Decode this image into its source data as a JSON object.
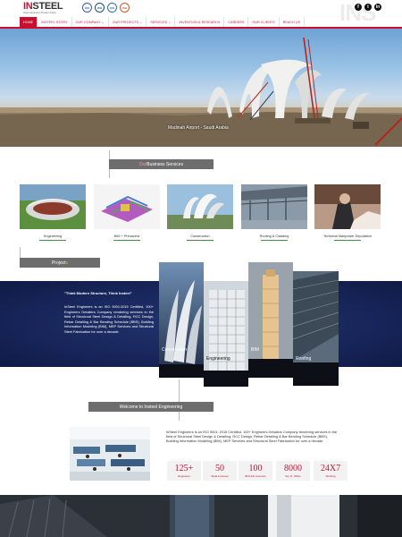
{
  "header": {
    "logo": "INSTEEL",
    "logo_tagline": "Insteel Engineers Private Limited",
    "cert_badges": [
      "ISO",
      "ISO",
      "ISO",
      "ISO"
    ],
    "watermark": "INS",
    "social": [
      "facebook-icon",
      "twitter-icon",
      "linkedin-icon"
    ]
  },
  "nav": {
    "items": [
      {
        "label": "HOME",
        "active": true
      },
      {
        "label": "INSTEEL STORY"
      },
      {
        "label": "OUR COMPANY ⌄"
      },
      {
        "label": "OUR PROJECTS ⌄"
      },
      {
        "label": "SERVICES ⌄"
      },
      {
        "label": "INVENTION & RESEARCH"
      },
      {
        "label": "CAREERS"
      },
      {
        "label": "OUR CLIENTS"
      },
      {
        "label": "REACH US"
      }
    ]
  },
  "hero": {
    "caption": "Madinah Airport - Saudi Arabia"
  },
  "services": {
    "title_prefix": "Our",
    "title_rest": " Business Services",
    "items": [
      {
        "label": "Engineering"
      },
      {
        "label": "BIM + Primavera"
      },
      {
        "label": "Construction"
      },
      {
        "label": "Roofing & Cladding"
      },
      {
        "label": "Technical Manpower Deputation"
      }
    ]
  },
  "projects": {
    "title_prefix": "Project",
    "title_rest": "s",
    "heading": "\"Think Modern Structure, Think Insteel\"",
    "text": "InSteel Engineers is an ISO 9001:2015 Certified, 100+ Engineers Detailers Company rendering services in the field of Structural Steel Design & Detailing, RCC Design, Rebar Detailing & Bar Bending Schedule (BBS), Building Information Modeling (BIM), MEP Services and Structural Steel Fabrication for over a decade.",
    "cards": [
      {
        "label": "Construction"
      },
      {
        "label": "Engineering"
      },
      {
        "label": "BIM"
      },
      {
        "label": "Roofing"
      }
    ]
  },
  "about": {
    "title": "Welcome to Insteel Engineering",
    "text": "InSteel Engineers is an ISO 9001: 2015 Certified, 100+ Engineers Detailers Company rendering services in the field of Structural Steel Design & Detailing, RCC Design, Rebar Detailing & Bar Bending Schedule (BBS), Building Information Modeling (BIM), MEP Services and Structural Steel Fabrication for over a decade.",
    "stats": [
      {
        "value": "125+",
        "label": "Engineers"
      },
      {
        "value": "50",
        "label": "Tekla Licenses"
      },
      {
        "value": "100",
        "label": "BOCAD Licenses"
      },
      {
        "value": "8000",
        "label": "Sq. Ft. Office"
      },
      {
        "value": "24X7",
        "label": "Working"
      }
    ]
  }
}
